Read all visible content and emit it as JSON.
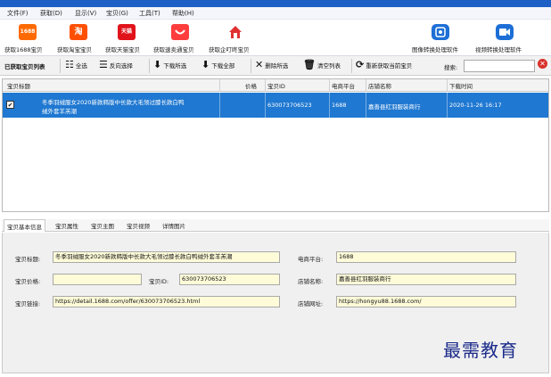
{
  "menu": [
    "文件(F)",
    "获取(D)",
    "显示(V)",
    "宝贝(G)",
    "工具(T)",
    "帮助(H)"
  ],
  "toolbar1": {
    "fetch_1688": {
      "label": "获取1688宝贝",
      "badge": "1688",
      "color": "#ff6a00"
    },
    "fetch_taobao": {
      "label": "获取淘宝宝贝",
      "badge": "淘",
      "color": "#ff5000"
    },
    "fetch_tmall": {
      "label": "获取天猫宝贝",
      "badge": "天猫",
      "color": "#e0131b"
    },
    "fetch_pdd_direct": {
      "label": "获取速卖通宝贝",
      "badge": "",
      "color": "#ff3d3d"
    },
    "fetch_pdd": {
      "label": "获取企叮咚宝贝",
      "badge": "",
      "color": "#e03131"
    },
    "image_convert": {
      "label": "图像转换处理软件",
      "color": "#1d6fd6"
    },
    "video_convert": {
      "label": "视频转换处理软件",
      "color": "#1d6fd6"
    }
  },
  "toolbar2": {
    "list_label": "已获取宝贝列表",
    "select_all": "全选",
    "invert": "反向选择",
    "download_selected": "下载所选",
    "download_all": "下载全部",
    "delete_selected": "删除所选",
    "clear_list": "清空列表",
    "refetch": "重新获取当前宝贝",
    "search_label": "搜索:",
    "search_value": ""
  },
  "grid": {
    "headers": [
      "宝贝标题",
      "价格",
      "宝贝ID",
      "电商平台",
      "店铺名称",
      "下载时间"
    ],
    "rows": [
      {
        "checked": "✔",
        "title_line1": "冬季羽绒服女2020新款韩版中长款大毛领过膝长款白鸭",
        "title_line2": "绒外套羊羔潮",
        "price": "",
        "id": "630073706523",
        "platform": "1688",
        "shop": "嘉善县红羽服装商行",
        "time": "2020-11-26 16:17"
      }
    ]
  },
  "tabs": [
    "宝贝基本信息",
    "宝贝属性",
    "宝贝主图",
    "宝贝视频",
    "详情图片"
  ],
  "detail": {
    "title_label": "宝贝标题:",
    "title_value": "冬季羽绒服女2020新款韩版中长款大毛领过膝长款白鸭绒外套羊羔潮",
    "platform_label": "电商平台:",
    "platform_value": "1688",
    "price_label": "宝贝价格:",
    "price_value": "",
    "id_label": "宝贝ID:",
    "id_value": "630073706523",
    "shop_label": "店铺名称:",
    "shop_value": "嘉善县红羽服装商行",
    "link_label": "宝贝链接:",
    "link_value": "https://detail.1688.com/offer/630073706523.html",
    "shop_url_label": "店铺网址:",
    "shop_url_value": "https://hongyu88.1688.com/"
  },
  "watermark": "最需教育",
  "colors": {
    "selection": "#1f78d1",
    "field_bg": "#fdfbd8",
    "accent": "#1e5fc6"
  }
}
